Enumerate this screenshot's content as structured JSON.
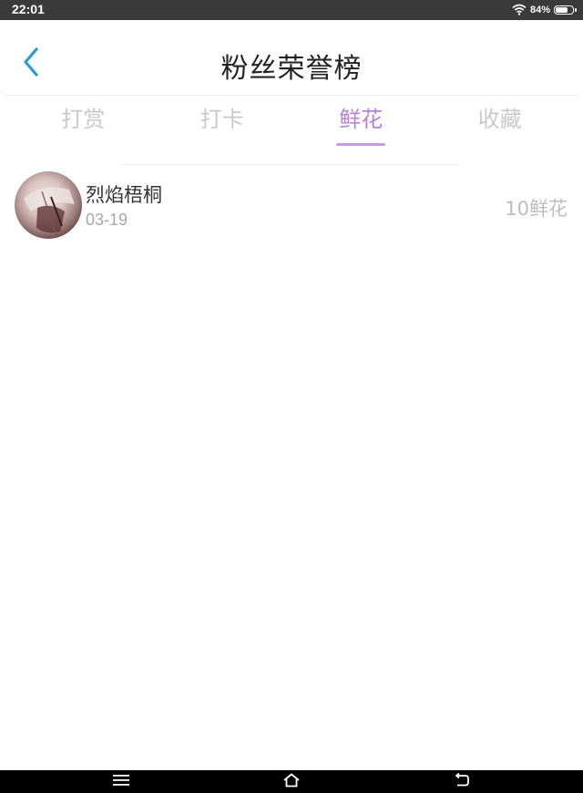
{
  "status_bar": {
    "time": "22:01",
    "battery": "84%",
    "battery_level": 0.84
  },
  "header": {
    "title": "粉丝荣誉榜"
  },
  "tabs": [
    {
      "label": "打赏",
      "active": false
    },
    {
      "label": "打卡",
      "active": false
    },
    {
      "label": "鲜花",
      "active": true
    },
    {
      "label": "收藏",
      "active": false
    }
  ],
  "list": [
    {
      "name": "烈焰梧桐",
      "date": "03-19",
      "amount": "10鲜花"
    }
  ],
  "colors": {
    "accent": "#b77fdb",
    "back": "#2a9bd8",
    "muted": "#c9c9c9"
  },
  "icons": {
    "back": "chevron-left-icon",
    "wifi": "wifi-icon",
    "battery": "battery-icon",
    "menu": "menu-icon",
    "home": "home-icon",
    "return": "back-nav-icon"
  }
}
